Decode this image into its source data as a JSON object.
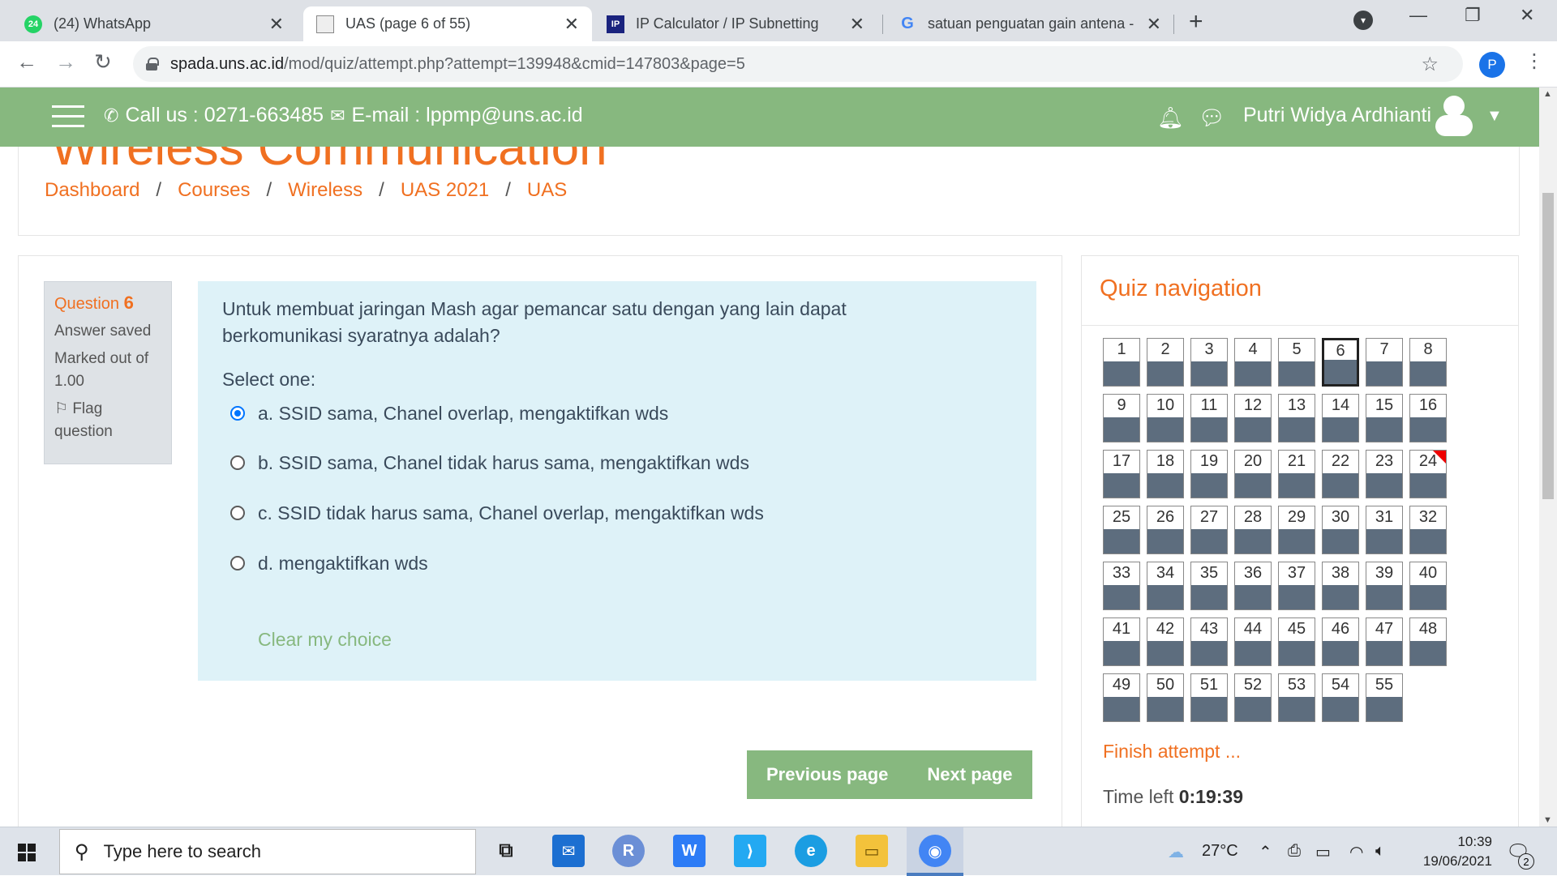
{
  "browser": {
    "tabs": [
      {
        "title": "(24) WhatsApp",
        "badge": "24"
      },
      {
        "title": "UAS (page 6 of 55)"
      },
      {
        "title": "IP Calculator / IP Subnetting",
        "favicon_text": "IP"
      },
      {
        "title": "satuan penguatan gain antena - "
      }
    ],
    "new_tab": "+",
    "url_host": "spada.uns.ac.id",
    "url_path": "/mod/quiz/attempt.php?attempt=139948&cmid=147803&page=5",
    "profile_initial": "P"
  },
  "site": {
    "contact": "Call us : 0271-663485",
    "email": "E-mail : lppmp@uns.ac.id",
    "user_name": "Putri Widya Ardhianti",
    "course_title_peek": "Wireless Communication",
    "breadcrumb": [
      "Dashboard",
      "Courses",
      "Wireless",
      "UAS 2021",
      "UAS"
    ],
    "breadcrumb_sep": "/"
  },
  "question": {
    "label": "Question",
    "number": "6",
    "state": "Answer saved",
    "grade": "Marked out of 1.00",
    "flag": "Flag question",
    "text": "Untuk membuat jaringan Mash agar pemancar satu dengan yang lain dapat berkomunikasi syaratnya adalah?",
    "prompt": "Select one:",
    "options": [
      "a. SSID sama, Chanel overlap, mengaktifkan wds",
      "b. SSID sama, Chanel tidak harus sama, mengaktifkan wds",
      "c. SSID tidak harus sama, Chanel overlap, mengaktifkan wds",
      "d. mengaktifkan wds"
    ],
    "selected_index": 0,
    "clear": "Clear my choice"
  },
  "pager": {
    "prev": "Previous page",
    "next": "Next page"
  },
  "quiz_nav": {
    "title": "Quiz navigation",
    "total": 55,
    "current": 6,
    "flagged": [
      24
    ],
    "finish": "Finish attempt ...",
    "time_label": "Time left",
    "time_value": "0:19:39"
  },
  "taskbar": {
    "search_placeholder": "Type here to search",
    "temperature": "27°C",
    "time": "10:39",
    "date": "19/06/2021",
    "notifications": "2",
    "colors": {
      "mail": "#1c6fd1",
      "r": "#6b8fd6",
      "wps": "#2d7cf6",
      "vscode": "#23a9f2",
      "edge": "#1b9de2",
      "explorer": "#f3c23b",
      "chrome": "#4285f4"
    }
  },
  "colors": {
    "accent": "#f07021",
    "nav_green": "#87b87f",
    "question_bg": "#def2f8",
    "qnav_bar": "#5d6d7e"
  }
}
